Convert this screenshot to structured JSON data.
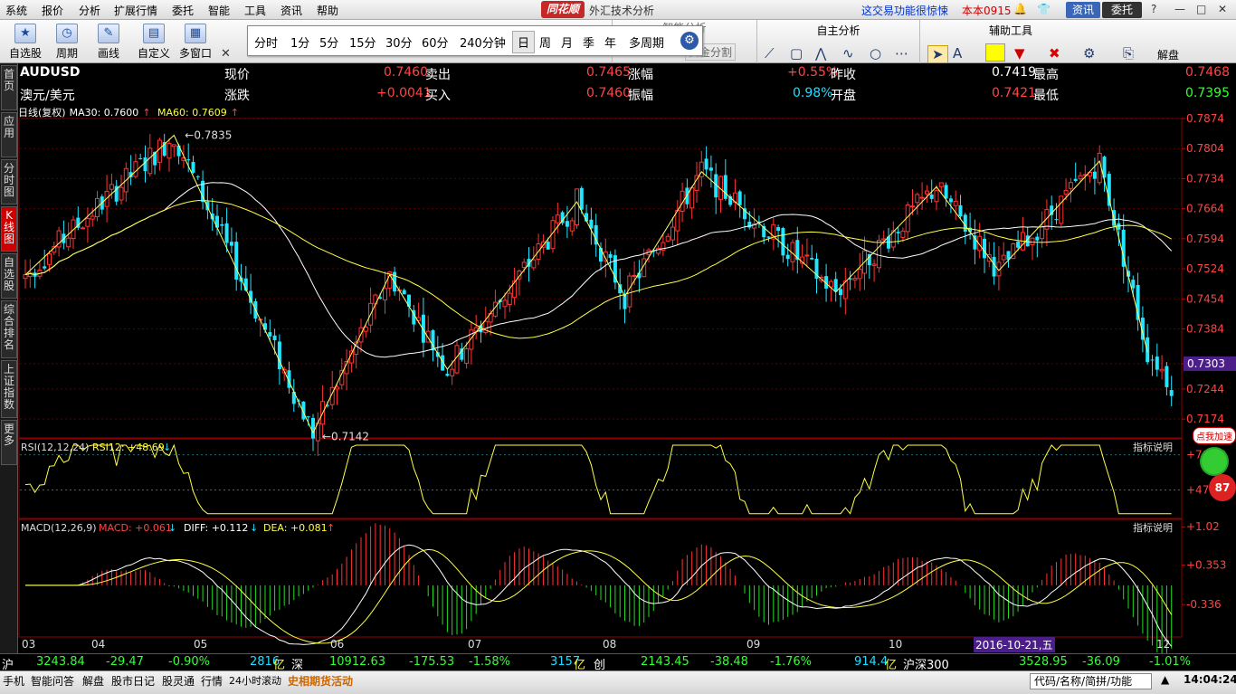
{
  "menubar": {
    "items": [
      "系统",
      "报价",
      "分析",
      "扩展行情",
      "委托",
      "智能",
      "工具",
      "资讯",
      "帮助"
    ],
    "logo": "同花顺",
    "title": "外汇技术分析",
    "promo": "这交易功能很惊悚",
    "version": "本本0915",
    "news_btn": "资讯",
    "trade_btn": "委托"
  },
  "toolbar": {
    "buttons": [
      "自选股",
      "周期",
      "画线",
      "自定义",
      "多窗口"
    ],
    "periods": [
      "分时",
      "1分",
      "5分",
      "15分",
      "30分",
      "60分",
      "240分钟",
      "日",
      "周",
      "月",
      "季",
      "年",
      "多周期"
    ],
    "selected_period": "日",
    "group_hidden_label": "智能分析",
    "group_self_analysis": "自主分析",
    "group_aux_tools": "辅助工具",
    "hidden_btn": "黄金分割",
    "solve_label": "解盘"
  },
  "sidebar": [
    "首页",
    "应用",
    "分时图",
    "K线图",
    "自选股",
    "综合排名",
    "上证指数",
    "更多"
  ],
  "quote": {
    "symbol": "AUDUSD",
    "name": "澳元/美元",
    "rows": [
      {
        "l1": "现价",
        "v1": "0.7460",
        "l2": "卖出",
        "v2": "0.7465",
        "l3": "涨幅",
        "v3": "+0.55%",
        "l4": "昨收",
        "v4": "0.7419",
        "l5": "最高",
        "v5": "0.7468"
      },
      {
        "l1": "涨跌",
        "v1": "+0.0041",
        "l2": "买入",
        "v2": "0.7460",
        "l3": "振幅",
        "v3": "0.98%",
        "l4": "开盘",
        "v4": "0.7421",
        "l5": "最低",
        "v5": "0.7395"
      }
    ]
  },
  "ma_legend": {
    "label": "日线(复权)",
    "ma30": "MA30: 0.7600",
    "ma60": "MA60: 0.7609"
  },
  "colors": {
    "up": "#ff3333",
    "down": "#22e5ff",
    "ma": "#ffff44",
    "rsi": "#ffff44",
    "diff": "#ffffff",
    "dea": "#ffff44"
  },
  "chart_data": {
    "type": "candlestick",
    "y_ticks": [
      "0.7874",
      "0.7804",
      "0.7734",
      "0.7664",
      "0.7594",
      "0.7524",
      "0.7454",
      "0.7384",
      "0.7303",
      "0.7244",
      "0.7174"
    ],
    "ylim": [
      0.713,
      0.7874
    ],
    "current_price_label": "0.7303",
    "high_annotation": "0.7835",
    "low_annotation": "0.7142",
    "x_labels": [
      "03",
      "04",
      "05",
      "06",
      "07",
      "08",
      "09",
      "10",
      "12"
    ],
    "cursor_date": "2016-10-21,五",
    "zigzag": [
      [
        0,
        0.751
      ],
      [
        31,
        0.7835
      ],
      [
        60,
        0.7142
      ],
      [
        76,
        0.751
      ],
      [
        88,
        0.729
      ],
      [
        115,
        0.768
      ],
      [
        125,
        0.746
      ],
      [
        141,
        0.775
      ],
      [
        169,
        0.747
      ],
      [
        190,
        0.7715
      ],
      [
        203,
        0.752
      ],
      [
        224,
        0.7775
      ],
      [
        234,
        0.733
      ]
    ],
    "rsi": {
      "label": "RSI(12,12,24)",
      "value": "RSI12: +48.69",
      "levels": [
        "+70.00",
        "+47.90"
      ],
      "ylim": [
        30,
        80
      ]
    },
    "macd": {
      "label": "MACD(12,26,9)",
      "macd": "MACD: +0.061",
      "diff": "DIFF: +0.112",
      "dea": "DEA: +0.081",
      "levels": [
        "+1.02",
        "+0.353",
        "-0.336"
      ],
      "ylim": [
        -0.9,
        1.15
      ]
    },
    "indicator_btn": "指标说明"
  },
  "ticker": {
    "items": [
      {
        "t": "沪",
        "c": "w"
      },
      {
        "t": "3243.84",
        "c": "g"
      },
      {
        "t": "-29.47",
        "c": "g"
      },
      {
        "t": "-0.90%",
        "c": "g"
      },
      {
        "t": "2816",
        "c": "c"
      },
      {
        "t": "亿",
        "c": "y"
      },
      {
        "t": "深",
        "c": "w"
      },
      {
        "t": "10912.63",
        "c": "g"
      },
      {
        "t": "-175.53",
        "c": "g"
      },
      {
        "t": "-1.58%",
        "c": "g"
      },
      {
        "t": "3157",
        "c": "c"
      },
      {
        "t": "亿",
        "c": "y"
      },
      {
        "t": "创",
        "c": "w"
      },
      {
        "t": "2143.45",
        "c": "g"
      },
      {
        "t": "-38.48",
        "c": "g"
      },
      {
        "t": "-1.76%",
        "c": "g"
      },
      {
        "t": "914.4",
        "c": "c"
      },
      {
        "t": "亿",
        "c": "y"
      },
      {
        "t": "沪深300",
        "c": "w"
      },
      {
        "t": "3528.95",
        "c": "g"
      },
      {
        "t": "-36.09",
        "c": "g"
      },
      {
        "t": "-1.01%",
        "c": "g"
      }
    ]
  },
  "statusbar": {
    "items": [
      "手机",
      "智能问答",
      "解盘",
      "股市日记",
      "股灵通",
      "行情",
      "24小时滚动",
      "史相期货活动"
    ],
    "code_placeholder": "代码/名称/简拼/功能",
    "clock": "14:04:24"
  },
  "badge": {
    "text": "点我加速",
    "num": "87"
  }
}
